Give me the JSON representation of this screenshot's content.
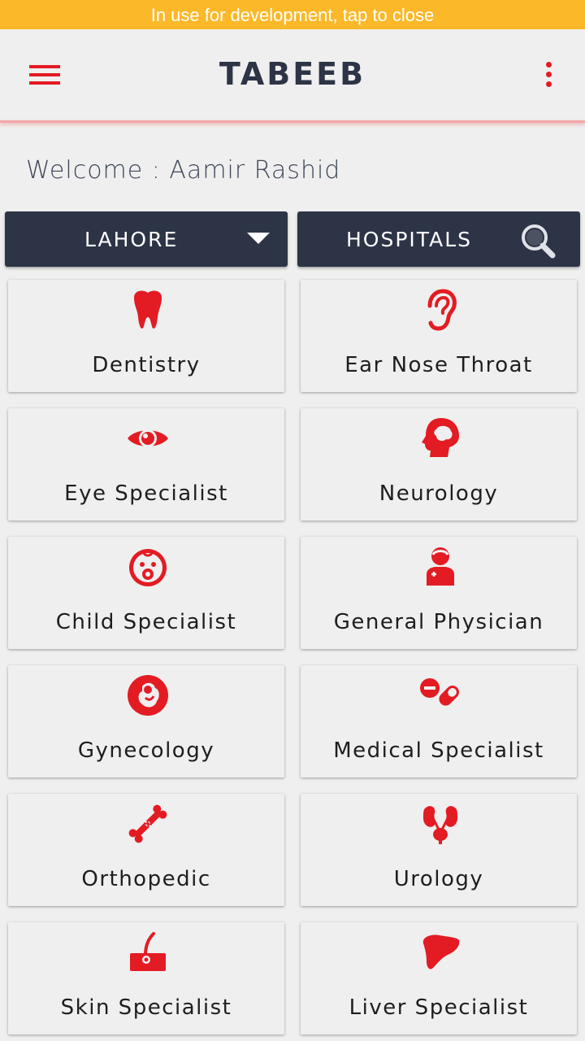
{
  "dev_banner": "In use for development, tap to close",
  "app": {
    "title": "TABEEB",
    "accent": "#e31b23",
    "navy": "#2c3446"
  },
  "welcome": "Welcome : Aamir Rashid",
  "filters": {
    "city": "LAHORE",
    "category": "HOSPITALS"
  },
  "specialties": [
    {
      "label": "Dentistry",
      "icon": "tooth-icon"
    },
    {
      "label": "Ear Nose Throat",
      "icon": "ear-icon"
    },
    {
      "label": "Eye Specialist",
      "icon": "eye-icon"
    },
    {
      "label": "Neurology",
      "icon": "brain-head-icon"
    },
    {
      "label": "Child Specialist",
      "icon": "baby-face-icon"
    },
    {
      "label": "General Physician",
      "icon": "physician-icon"
    },
    {
      "label": "Gynecology",
      "icon": "fetus-icon"
    },
    {
      "label": "Medical Specialist",
      "icon": "pills-icon"
    },
    {
      "label": "Orthopedic",
      "icon": "broken-bone-icon"
    },
    {
      "label": "Urology",
      "icon": "kidneys-icon"
    },
    {
      "label": "Skin Specialist",
      "icon": "skin-hair-icon"
    },
    {
      "label": "Liver Specialist",
      "icon": "liver-icon"
    }
  ]
}
